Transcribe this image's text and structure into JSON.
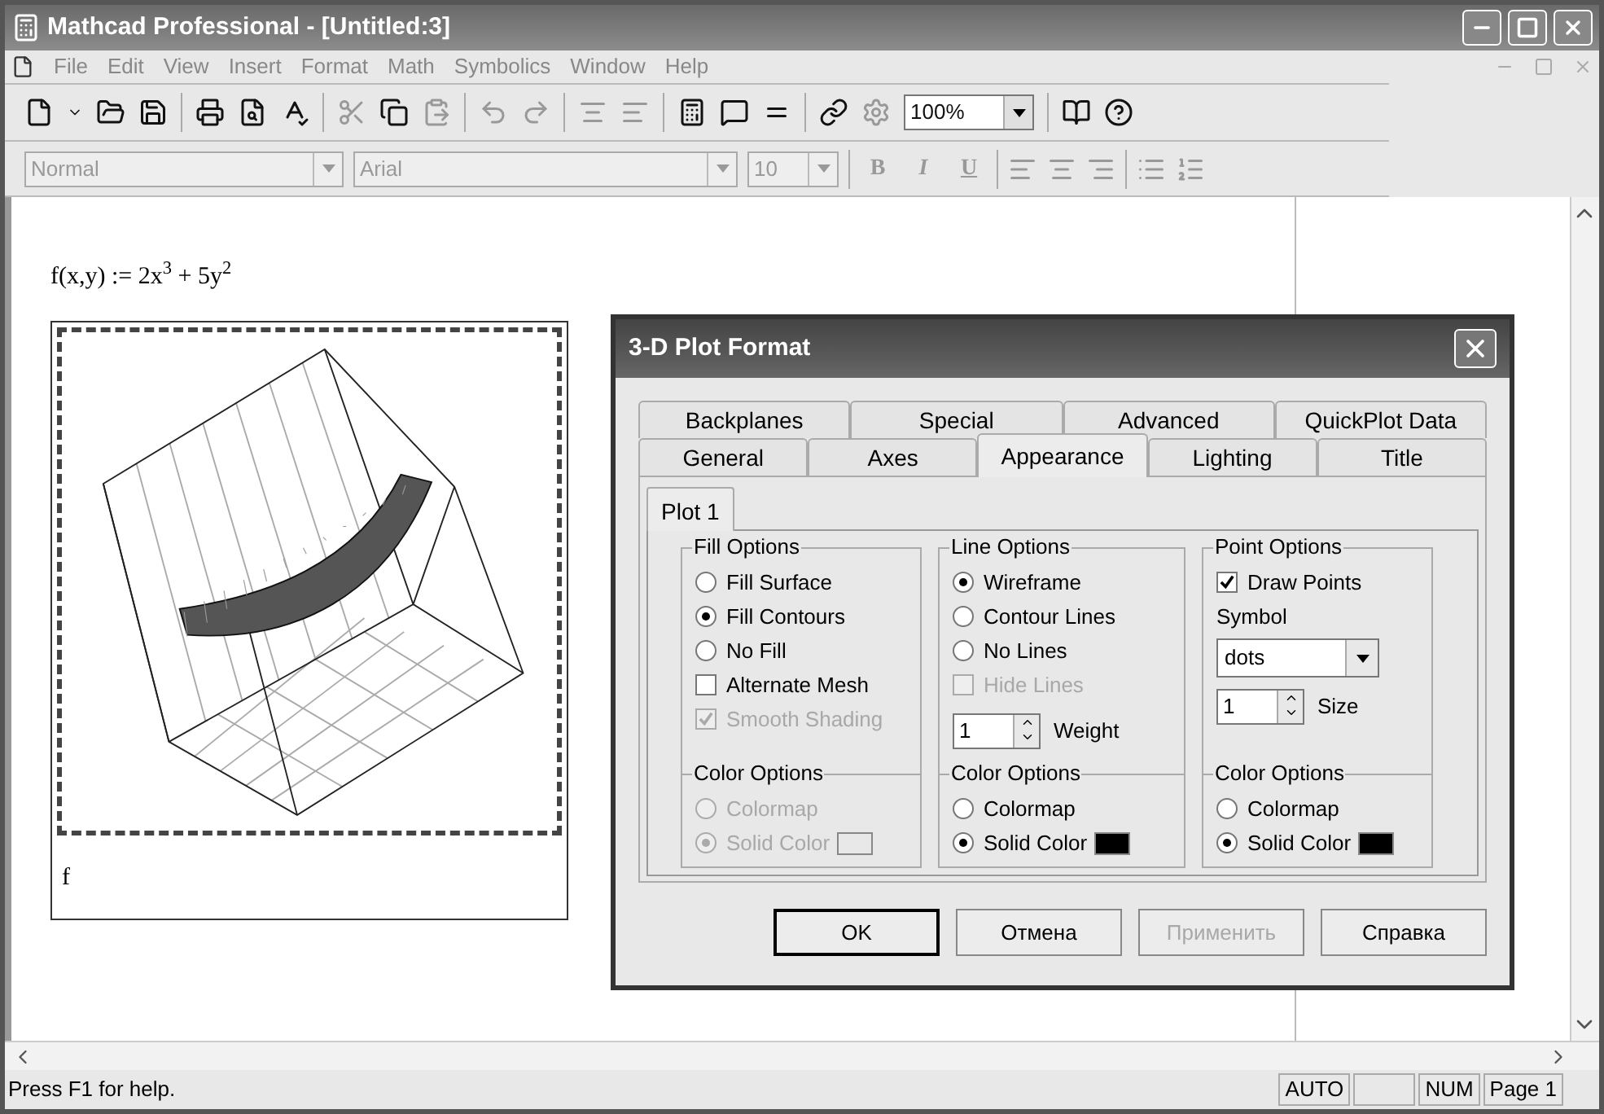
{
  "window": {
    "title": "Mathcad Professional - [Untitled:3]"
  },
  "menu": [
    "File",
    "Edit",
    "View",
    "Insert",
    "Format",
    "Math",
    "Symbolics",
    "Window",
    "Help"
  ],
  "toolbar": {
    "zoom": "100%"
  },
  "format_bar": {
    "style": "Normal",
    "font": "Arial",
    "size": "10",
    "styles": [
      "B",
      "I",
      "U"
    ]
  },
  "document": {
    "formula": "f(x,y) := 2x$^{3}$ + 5y$^{2}$",
    "plot_label": "f"
  },
  "dialog": {
    "title": "3-D Plot Format",
    "tab_rows": [
      [
        {
          "label": "Backplanes",
          "selected": false
        },
        {
          "label": "Special",
          "selected": false
        },
        {
          "label": "Advanced",
          "selected": false
        },
        {
          "label": "QuickPlot Data",
          "selected": false
        }
      ],
      [
        {
          "label": "General",
          "selected": false
        },
        {
          "label": "Axes",
          "selected": false
        },
        {
          "label": "Appearance",
          "selected": true
        },
        {
          "label": "Lighting",
          "selected": false
        },
        {
          "label": "Title",
          "selected": false
        }
      ]
    ],
    "subtabs": [
      {
        "label": "Plot 1",
        "selected": true
      }
    ],
    "columns": [
      {
        "title": "Fill Options",
        "items": [
          {
            "kind": "radio",
            "label": "Fill Surface",
            "checked": false,
            "disabled": false
          },
          {
            "kind": "radio",
            "label": "Fill Contours",
            "checked": true,
            "disabled": false
          },
          {
            "kind": "radio",
            "label": "No Fill",
            "checked": false,
            "disabled": false
          },
          {
            "kind": "checkbox",
            "label": "Alternate Mesh",
            "checked": false,
            "disabled": false
          },
          {
            "kind": "checkbox",
            "label": "Smooth Shading",
            "checked": true,
            "disabled": true
          }
        ],
        "color_title": "Color Options",
        "color_items": [
          {
            "label": "Colormap",
            "checked": false,
            "disabled": true
          },
          {
            "label": "Solid Color",
            "checked": true,
            "disabled": true,
            "color": "#e8e8e8"
          }
        ]
      },
      {
        "title": "Line Options",
        "items": [
          {
            "kind": "radio",
            "label": "Wireframe",
            "checked": true,
            "disabled": false
          },
          {
            "kind": "radio",
            "label": "Contour Lines",
            "checked": false,
            "disabled": false
          },
          {
            "kind": "radio",
            "label": "No Lines",
            "checked": false,
            "disabled": false
          },
          {
            "kind": "checkbox",
            "label": "Hide Lines",
            "checked": false,
            "disabled": true
          },
          {
            "kind": "spinner",
            "label": "Weight",
            "field": {
              "value": "1"
            }
          }
        ],
        "color_title": "Color Options",
        "color_items": [
          {
            "label": "Colormap",
            "checked": false,
            "disabled": false
          },
          {
            "label": "Solid Color",
            "checked": true,
            "disabled": false,
            "color": "#000000"
          }
        ]
      },
      {
        "title": "Point Options",
        "items": [
          {
            "kind": "checkbox",
            "label": "Draw Points",
            "checked": true,
            "disabled": false
          },
          {
            "kind": "text",
            "label": "Symbol"
          },
          {
            "kind": "dropdown",
            "value": "dots"
          },
          {
            "kind": "spinner",
            "label": "Size",
            "field": {
              "value": "1"
            }
          }
        ],
        "color_title": "Color Options",
        "color_items": [
          {
            "label": "Colormap",
            "checked": false,
            "disabled": false
          },
          {
            "label": "Solid Color",
            "checked": true,
            "disabled": false,
            "color": "#000000"
          }
        ]
      }
    ],
    "buttons": [
      {
        "label": "OK",
        "default": true,
        "disabled": false
      },
      {
        "label": "Отмена",
        "default": false,
        "disabled": false
      },
      {
        "label": "Применить",
        "default": false,
        "disabled": true
      },
      {
        "label": "Справка",
        "default": false,
        "disabled": false
      }
    ]
  },
  "status_bar": {
    "help": "Press F1 for help.",
    "panels": [
      "AUTO",
      "NUM",
      "Page 1"
    ]
  }
}
